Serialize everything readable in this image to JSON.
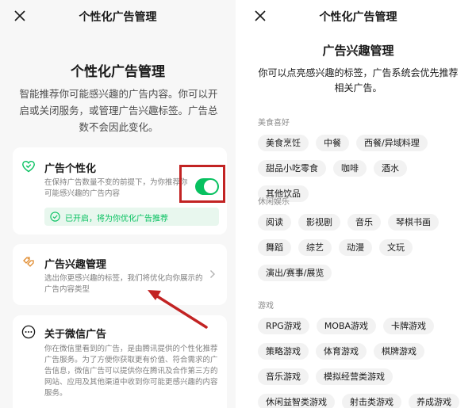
{
  "left": {
    "nav_title": "个性化广告管理",
    "heading": "个性化广告管理",
    "description": "智能推荐你可能感兴趣的广告内容。你可以开启或关闭服务，或管理广告兴趣标签。广告总数不会因此变化。",
    "card_personalization": {
      "icon": "heart-icon",
      "title": "广告个性化",
      "description": "在保持广告数量不变的前提下，为你推荐你可能感兴趣的广告内容",
      "toggle_on": true,
      "status": "已开启，将为你优化广告推荐"
    },
    "card_interest": {
      "icon": "interest-tags-icon",
      "title": "广告兴趣管理",
      "description": "选出你更感兴趣的标签，我们将优化向你展示的广告内容类型"
    },
    "card_about": {
      "icon": "more-icon",
      "title": "关于微信广告",
      "description": "你在微信里看到的广告，是由腾讯提供的个性化推荐广告服务。为了方便你获取更有价值、符合需求的广告信息，微信广告可以提供你在腾讯及合作第三方的网站、应用及其他渠道中收到你可能更感兴趣的内容服务。"
    },
    "accent_color": "#07c160",
    "annotation_color": "#c22323"
  },
  "right": {
    "nav_title": "个性化广告管理",
    "heading": "广告兴趣管理",
    "description": "你可以点亮感兴趣的标签，广告系统会优先推荐相关广告。",
    "categories": [
      {
        "name": "美食喜好",
        "tags": [
          "美食烹饪",
          "中餐",
          "西餐/异域料理",
          "甜品小吃零食",
          "咖啡",
          "酒水",
          "其他饮品"
        ]
      },
      {
        "name": "休闲娱乐",
        "tags": [
          "阅读",
          "影视剧",
          "音乐",
          "琴棋书画",
          "舞蹈",
          "综艺",
          "动漫",
          "文玩",
          "演出/赛事/展览"
        ]
      },
      {
        "name": "游戏",
        "tags": [
          "RPG游戏",
          "MOBA游戏",
          "卡牌游戏",
          "策略游戏",
          "体育游戏",
          "棋牌游戏",
          "音乐游戏",
          "模拟经营类游戏",
          "休闲益智类游戏",
          "射击类游戏",
          "养成游戏"
        ]
      }
    ]
  }
}
